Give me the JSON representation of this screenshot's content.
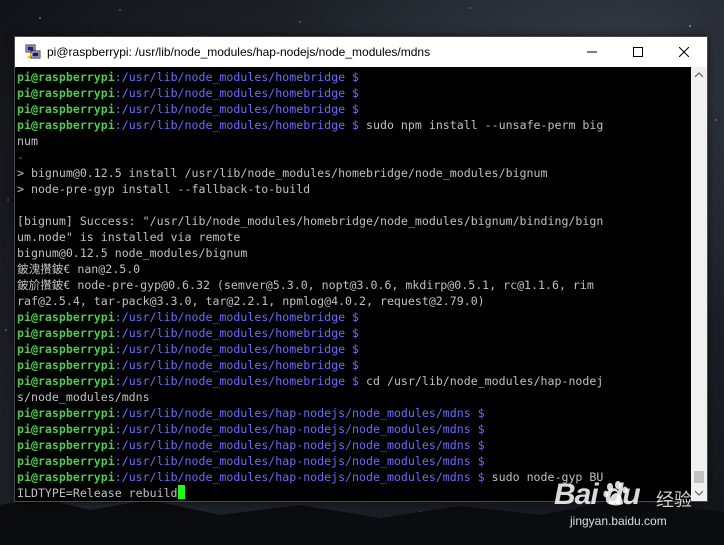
{
  "window": {
    "title": "pi@raspberrypi: /usr/lib/node_modules/hap-nodejs/node_modules/mdns",
    "icon": "putty-icon",
    "controls": [
      "minimize-icon",
      "maximize-icon",
      "close-icon"
    ]
  },
  "terminal": {
    "lines": [
      {
        "prompt": "pi@raspberrypi",
        "path": ":/usr/lib/node_modules/homebridge",
        "sign": " $",
        "text": ""
      },
      {
        "prompt": "pi@raspberrypi",
        "path": ":/usr/lib/node_modules/homebridge",
        "sign": " $",
        "text": ""
      },
      {
        "prompt": "pi@raspberrypi",
        "path": ":/usr/lib/node_modules/homebridge",
        "sign": " $",
        "text": ""
      },
      {
        "prompt": "pi@raspberrypi",
        "path": ":/usr/lib/node_modules/homebridge",
        "sign": " $",
        "text": " sudo npm install --unsafe-perm big"
      },
      {
        "text": "num"
      },
      {
        "text": "-",
        "style": "red"
      },
      {
        "text": "> bignum@0.12.5 install /usr/lib/node_modules/homebridge/node_modules/bignum"
      },
      {
        "text": "> node-pre-gyp install --fallback-to-build"
      },
      {
        "text": ""
      },
      {
        "text": "[bignum] Success: \"/usr/lib/node_modules/homebridge/node_modules/bignum/binding/bign"
      },
      {
        "text": "um.node\" is installed via remote"
      },
      {
        "text": "bignum@0.12.5 node_modules/bignum"
      },
      {
        "text": "鈹溾攢鈹€ nan@2.5.0"
      },
      {
        "text": "鈹斺攢鈹€ node-pre-gyp@0.6.32 (semver@5.3.0, nopt@3.0.6, mkdirp@0.5.1, rc@1.1.6, rim"
      },
      {
        "text": "raf@2.5.4, tar-pack@3.3.0, tar@2.2.1, npmlog@4.0.2, request@2.79.0)"
      },
      {
        "prompt": "pi@raspberrypi",
        "path": ":/usr/lib/node_modules/homebridge",
        "sign": " $",
        "text": ""
      },
      {
        "prompt": "pi@raspberrypi",
        "path": ":/usr/lib/node_modules/homebridge",
        "sign": " $",
        "text": ""
      },
      {
        "prompt": "pi@raspberrypi",
        "path": ":/usr/lib/node_modules/homebridge",
        "sign": " $",
        "text": ""
      },
      {
        "prompt": "pi@raspberrypi",
        "path": ":/usr/lib/node_modules/homebridge",
        "sign": " $",
        "text": ""
      },
      {
        "prompt": "pi@raspberrypi",
        "path": ":/usr/lib/node_modules/homebridge",
        "sign": " $",
        "text": " cd /usr/lib/node_modules/hap-nodej"
      },
      {
        "text": "s/node_modules/mdns"
      },
      {
        "prompt": "pi@raspberrypi",
        "path": ":/usr/lib/node_modules/hap-nodejs/node_modules/mdns",
        "sign": " $",
        "text": ""
      },
      {
        "prompt": "pi@raspberrypi",
        "path": ":/usr/lib/node_modules/hap-nodejs/node_modules/mdns",
        "sign": " $",
        "text": ""
      },
      {
        "prompt": "pi@raspberrypi",
        "path": ":/usr/lib/node_modules/hap-nodejs/node_modules/mdns",
        "sign": " $",
        "text": ""
      },
      {
        "prompt": "pi@raspberrypi",
        "path": ":/usr/lib/node_modules/hap-nodejs/node_modules/mdns",
        "sign": " $",
        "text": ""
      },
      {
        "prompt": "pi@raspberrypi",
        "path": ":/usr/lib/node_modules/hap-nodejs/node_modules/mdns",
        "sign": " $",
        "text": " sudo node-gyp BU"
      },
      {
        "text": "ILDTYPE=Release rebuild",
        "cursor": true
      }
    ],
    "colors": {
      "prompt": "#4ec94e",
      "path": "#6b6bff",
      "text": "#c0c0c0",
      "cursor": "#1aff1a",
      "background": "#000000"
    }
  },
  "watermark": {
    "logo": "Bai  du",
    "cn": "经验",
    "url": "jingyan.baidu.com"
  }
}
